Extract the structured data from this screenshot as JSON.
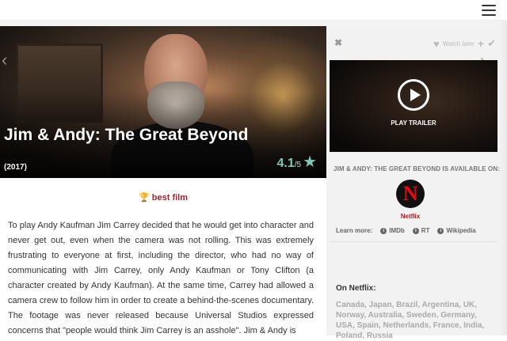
{
  "movie": {
    "title": "Jim & Andy: The Great Beyond",
    "year": "(2017)",
    "rating": "4.1",
    "rating_max": "/5",
    "award": "best film",
    "synopsis": "To play Andy Kaufman Jim Carrey decided that he would get into character and never get out, even when the camera was not rolling. This was extremely frustrating to everyone at first, including the director, who had no way of communicating with Jim Carrey, only Andy Kaufman or Tony Clifton (a character created by Andy Kaufman). At the same time, Carrey had allowed a camera crew to follow him in order to create a behind-the-scenes documentary. The footage was never released because Universal Studios expressed concerns that \"people would think Jim Carrey is an asshole\". Jim & Andy is"
  },
  "sidebar": {
    "watch_later": "Watch later",
    "play_trailer": "PLAY TRAILER",
    "available_on": "JIM & ANDY: THE GREAT BEYOND IS AVAILABLE ON:",
    "provider": "Netflix",
    "provider_logo_letter": "N",
    "learn_more": "Learn more:",
    "links": [
      "IMDb",
      "RT",
      "Wikipedia"
    ],
    "on_netflix": "On Netflix:",
    "countries": "Canada, Japan, Brazil, Argentina, UK, Norway, Australia, Sweden, Germany, USA, Spain, Netherlands, France, India, Poland, Russia"
  },
  "colors": {
    "accent_red": "#a3252d",
    "rating_teal": "#7fc7b5",
    "netflix_red": "#e50914"
  },
  "icons": [
    "menu-icon",
    "close-icon",
    "heart-icon",
    "plus-icon",
    "check-icon",
    "star-icon",
    "trophy-icon",
    "play-icon",
    "info-icon",
    "chevron-left-icon",
    "chevron-right-icon"
  ]
}
